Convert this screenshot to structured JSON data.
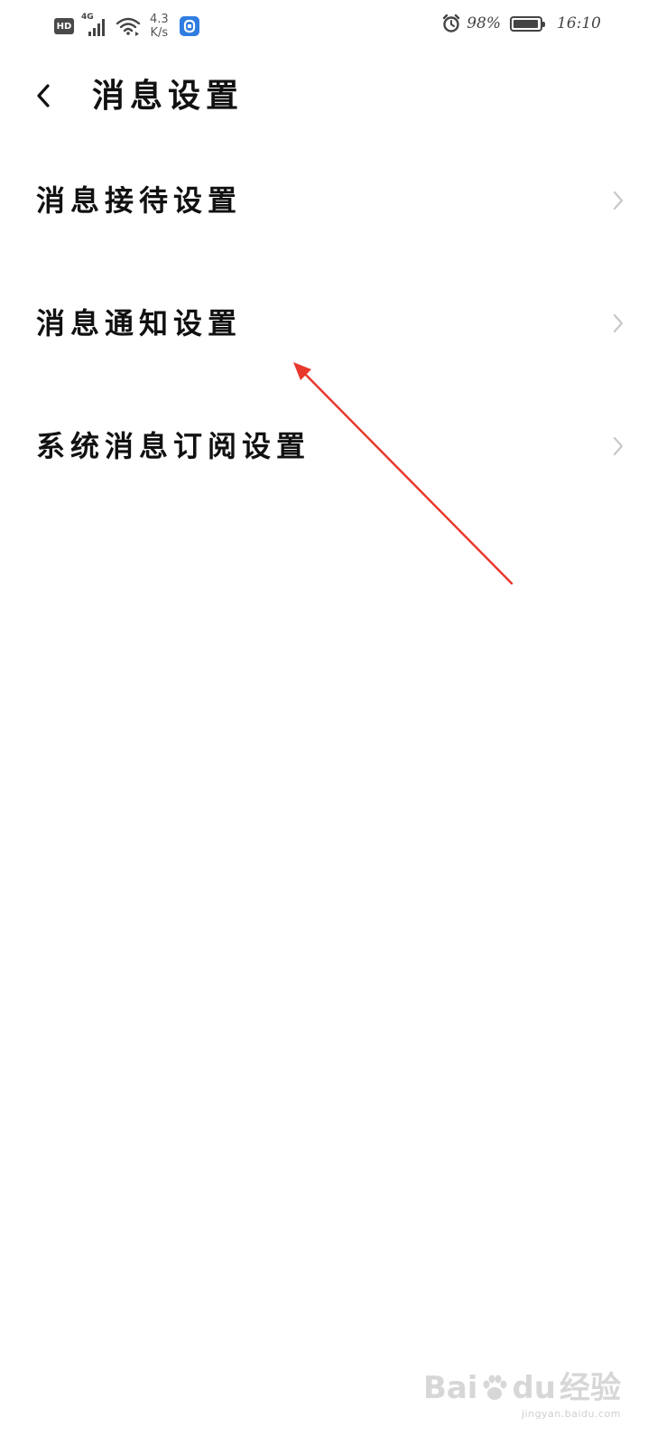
{
  "status_bar": {
    "hd_label": "HD",
    "network_label": "4G",
    "speed_value": "4.3",
    "speed_unit": "K/s",
    "battery_percent": "98%",
    "battery_level": 0.98,
    "time": "16:10",
    "icons": [
      "hd-icon",
      "signal-icon",
      "wifi-icon",
      "app-notification-icon",
      "alarm-icon",
      "battery-icon"
    ]
  },
  "header": {
    "title": "消息设置",
    "back_icon": "chevron-left-icon"
  },
  "menu": {
    "items": [
      {
        "label": "消息接待设置"
      },
      {
        "label": "消息通知设置"
      },
      {
        "label": "系统消息订阅设置"
      }
    ],
    "chevron_icon": "chevron-right-icon"
  },
  "annotation": {
    "color": "#e8382b"
  },
  "watermark": {
    "logo_text_a": "Bai",
    "logo_text_b": "du",
    "logo_cn": "经验",
    "url": "jingyan.baidu.com"
  },
  "colors": {
    "background": "#ffffff",
    "text": "#111111",
    "chevron": "#c8c8c8",
    "app_badge": "#2f7de1"
  }
}
